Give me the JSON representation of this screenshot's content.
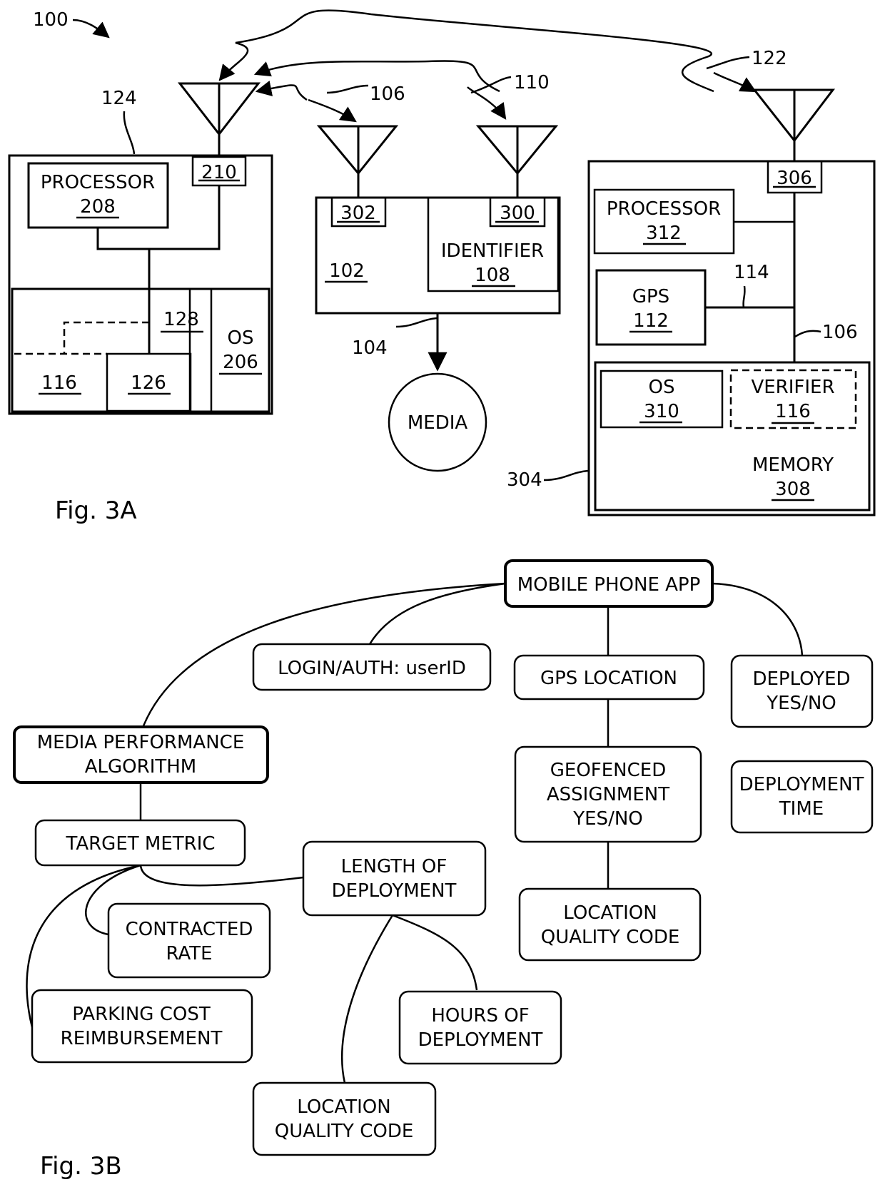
{
  "figure_3a": {
    "caption": "Fig. 3A",
    "system_ref": "100",
    "signals": {
      "s122": "122",
      "s110": "110",
      "s106": "106"
    },
    "left_device": {
      "ref": "124",
      "transceiver": "210",
      "processor_label": "PROCESSOR",
      "processor_ref": "208",
      "bus_ref": "128",
      "module_116": "116",
      "module_126": "126",
      "os_label": "OS",
      "os_ref": "206"
    },
    "center_device": {
      "ref": "102",
      "transceiver_a": "302",
      "transceiver_b": "300",
      "identifier_label": "IDENTIFIER",
      "identifier_ref": "108",
      "link_ref": "104",
      "media_label": "MEDIA"
    },
    "right_device": {
      "ref": "304",
      "transceiver": "306",
      "processor_label": "PROCESSOR",
      "processor_ref": "312",
      "gps_label": "GPS",
      "gps_ref": "112",
      "gps_link_ref": "114",
      "bus_ref": "106",
      "os_label": "OS",
      "os_ref": "310",
      "verifier_label": "VERIFIER",
      "verifier_ref": "116",
      "memory_label": "MEMORY",
      "memory_ref": "308"
    }
  },
  "figure_3b": {
    "caption": "Fig. 3B",
    "nodes": {
      "mobile_app": [
        "MOBILE PHONE APP"
      ],
      "login": [
        "LOGIN/AUTH: userID"
      ],
      "gps_location": [
        "GPS LOCATION"
      ],
      "deployed": [
        "DEPLOYED",
        "YES/NO"
      ],
      "media_algo": [
        "MEDIA PERFORMANCE",
        "ALGORITHM"
      ],
      "geofenced": [
        "GEOFENCED",
        "ASSIGNMENT",
        "YES/NO"
      ],
      "deployment_time": [
        "DEPLOYMENT",
        "TIME"
      ],
      "target_metric": [
        "TARGET METRIC"
      ],
      "length_deployment": [
        "LENGTH OF",
        "DEPLOYMENT"
      ],
      "contracted_rate": [
        "CONTRACTED",
        "RATE"
      ],
      "location_quality_right": [
        "LOCATION",
        "QUALITY CODE"
      ],
      "parking_cost": [
        "PARKING COST",
        "REIMBURSEMENT"
      ],
      "hours_deployment": [
        "HOURS OF",
        "DEPLOYMENT"
      ],
      "location_quality_bottom": [
        "LOCATION",
        "QUALITY CODE"
      ]
    }
  }
}
